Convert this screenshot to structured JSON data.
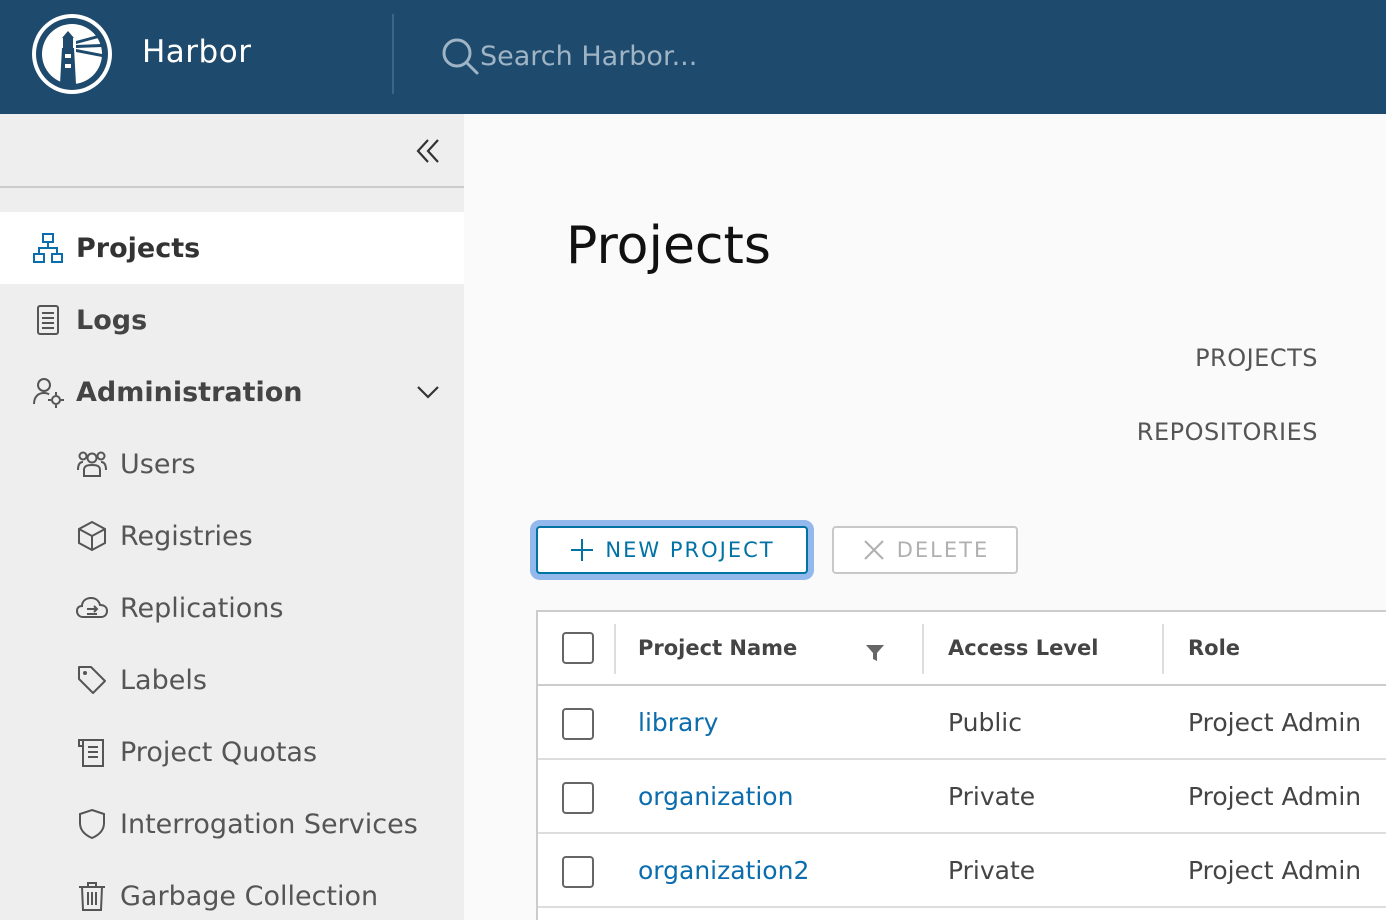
{
  "header": {
    "brand": "Harbor",
    "search_placeholder": "Search Harbor..."
  },
  "sidebar": {
    "items": [
      {
        "label": "Projects",
        "icon": "projects-icon",
        "active": true
      },
      {
        "label": "Logs",
        "icon": "logs-icon"
      },
      {
        "label": "Administration",
        "icon": "administration-icon",
        "expanded": true
      }
    ],
    "admin_items": [
      {
        "label": "Users",
        "icon": "users-icon"
      },
      {
        "label": "Registries",
        "icon": "registries-icon"
      },
      {
        "label": "Replications",
        "icon": "replications-icon"
      },
      {
        "label": "Labels",
        "icon": "labels-icon"
      },
      {
        "label": "Project Quotas",
        "icon": "project-quotas-icon"
      },
      {
        "label": "Interrogation Services",
        "icon": "interrogation-services-icon"
      },
      {
        "label": "Garbage Collection",
        "icon": "garbage-collection-icon"
      }
    ]
  },
  "main": {
    "title": "Projects",
    "stats": {
      "projects_label": "PROJECTS",
      "repositories_label": "REPOSITORIES"
    },
    "buttons": {
      "new_project": "NEW PROJECT",
      "delete": "DELETE"
    },
    "table": {
      "columns": [
        "Project Name",
        "Access Level",
        "Role"
      ],
      "rows": [
        {
          "name": "library",
          "access": "Public",
          "role": "Project Admin"
        },
        {
          "name": "organization",
          "access": "Private",
          "role": "Project Admin"
        },
        {
          "name": "organization2",
          "access": "Private",
          "role": "Project Admin"
        }
      ]
    }
  },
  "colors": {
    "header_bg": "#1d4a6d",
    "sidebar_bg": "#eeeeee",
    "primary": "#0072a3",
    "link": "#0b6dad"
  }
}
